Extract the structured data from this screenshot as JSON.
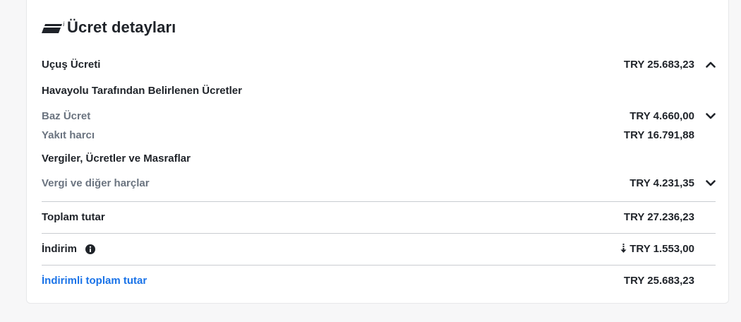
{
  "title": "Ücret detayları",
  "flight_fare": {
    "label": "Uçuş Ücreti",
    "amount": "TRY 25.683,23"
  },
  "airline_section": {
    "title": "Havayolu Tarafından Belirlenen Ücretler",
    "base_fare": {
      "label": "Baz Ücret",
      "amount": "TRY 4.660,00"
    },
    "fuel_fee": {
      "label": "Yakıt harcı",
      "amount": "TRY 16.791,88"
    }
  },
  "taxes_section": {
    "title": "Vergiler, Ücretler ve Masraflar",
    "tax_other": {
      "label": "Vergi ve diğer harçlar",
      "amount": "TRY 4.231,35"
    }
  },
  "total": {
    "label": "Toplam tutar",
    "amount": "TRY 27.236,23"
  },
  "discount": {
    "label": "İndirim",
    "amount": "TRY 1.553,00"
  },
  "discounted_total": {
    "label": "İndirimli toplam tutar",
    "amount": "TRY 25.683,23"
  },
  "colors": {
    "link": "#1a73e8",
    "muted": "#6b7480",
    "divider": "#c9ccd1",
    "text": "#1f2329"
  },
  "icons": [
    "ticket-icon",
    "chevron-up-icon",
    "chevron-down-icon",
    "info-icon",
    "down-arrow-icon"
  ]
}
